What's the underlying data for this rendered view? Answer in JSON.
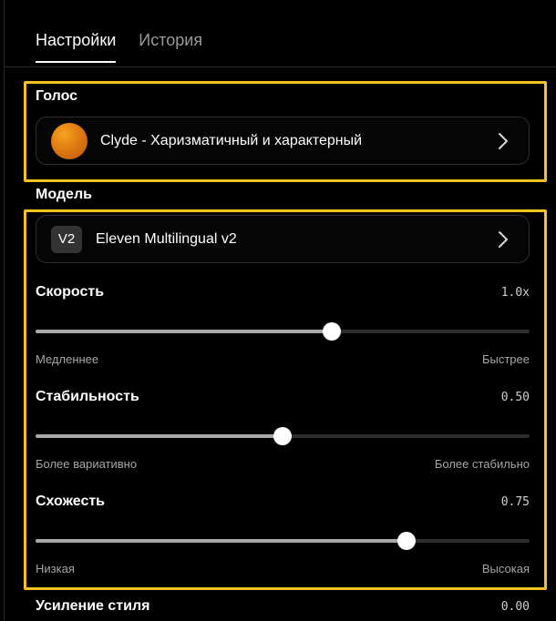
{
  "tabs": {
    "settings": "Настройки",
    "history": "История"
  },
  "voice": {
    "label": "Голос",
    "name": "Clyde - Харизматичный и характерный"
  },
  "model": {
    "label": "Модель",
    "badge": "V2",
    "name": "Eleven Multilingual v2"
  },
  "speed": {
    "label": "Скорость",
    "value": "1.0x",
    "min_label": "Медленнее",
    "max_label": "Быстрее",
    "level": 0.6
  },
  "stability": {
    "label": "Стабильность",
    "value": "0.50",
    "min_label": "Более вариативно",
    "max_label": "Более стабильно",
    "level": 0.5
  },
  "similarity": {
    "label": "Схожесть",
    "value": "0.75",
    "min_label": "Низкая",
    "max_label": "Высокая",
    "level": 0.75
  },
  "style": {
    "label": "Усиление стиля",
    "value": "0.00"
  },
  "colors": {
    "highlight": "#f7c21b",
    "track": "#2d2d2d",
    "fill": "#a8a8a8",
    "orb": "#e07b12"
  },
  "icons": {
    "voice_avatar": "orange-orb",
    "chevron": "chevron-right-icon"
  }
}
